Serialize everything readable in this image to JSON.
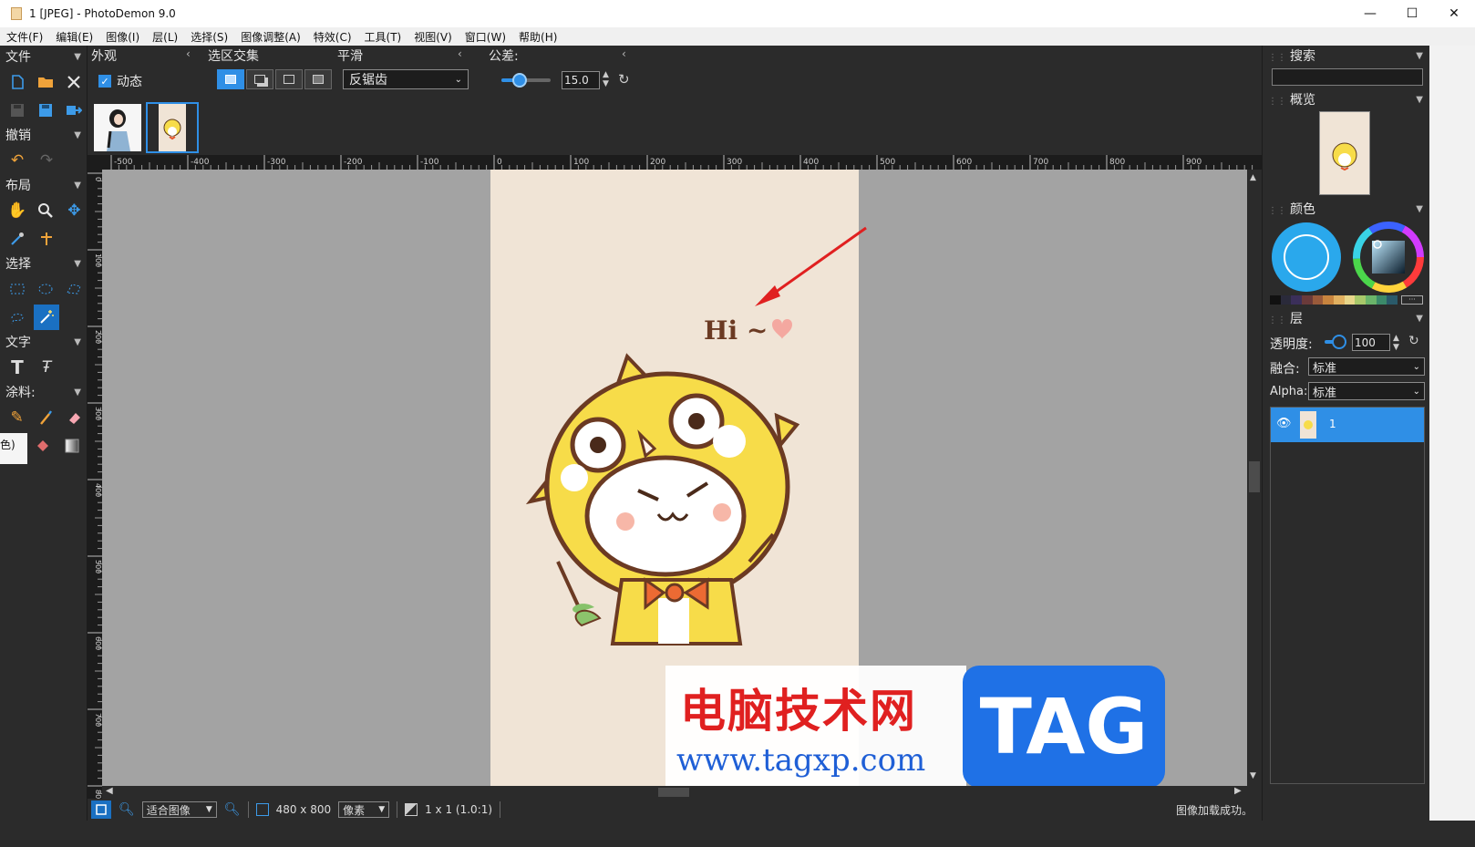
{
  "window": {
    "title": "1 [JPEG]  -  PhotoDemon 9.0",
    "minimize": "—",
    "maximize": "☐",
    "close": "✕"
  },
  "menu": [
    "文件(F)",
    "编辑(E)",
    "图像(I)",
    "层(L)",
    "选择(S)",
    "图像调整(A)",
    "特效(C)",
    "工具(T)",
    "视图(V)",
    "窗口(W)",
    "帮助(H)"
  ],
  "left": {
    "file": "文件",
    "undo": "撤销",
    "layout": "布局",
    "select": "选择",
    "text": "文字",
    "paint": "涂料:",
    "cut_text": "色)"
  },
  "options": {
    "appearance": "外观",
    "animated_label": "动态",
    "animated_checked": true,
    "selection_combine": "选区交集",
    "smoothing": "平滑",
    "smoothing_value": "反锯齿",
    "tolerance": "公差:",
    "tolerance_value": "15.0",
    "tolerance_level": 0.15
  },
  "rulers": {
    "h_labels": [
      "-500",
      "-400",
      "-300",
      "-200",
      "-100",
      "0",
      "100",
      "200",
      "300",
      "400",
      "500",
      "600",
      "700",
      "800",
      "900"
    ],
    "v_labels": [
      "0",
      "100",
      "200",
      "300",
      "400",
      "500",
      "600",
      "700",
      "800"
    ]
  },
  "canvas": {
    "hi_text": "Hi ~",
    "bg_color": "#a3a3a3",
    "image_bg_color": "#f0e4d6"
  },
  "ad": {
    "title": "电脑技术网",
    "url": "www.tagxp.com",
    "tag": "TAG"
  },
  "status": {
    "zoom": "适合图像",
    "size": "480 x 800",
    "unit": "像素",
    "ratio": "1 x 1  (1.0:1)",
    "message": "图像加载成功。"
  },
  "right": {
    "search": "搜索",
    "overview": "概览",
    "color": "颜色",
    "layer": "层",
    "opacity_label": "透明度:",
    "opacity_value": "100",
    "blend_label": "融合:",
    "blend_value": "标准",
    "alpha_label": "Alpha:",
    "alpha_value": "标准",
    "layer_name": "1"
  },
  "colors": {
    "accent": "#1a70c2",
    "layer_selected": "#2f8fe6",
    "arrow": "#e02020"
  }
}
